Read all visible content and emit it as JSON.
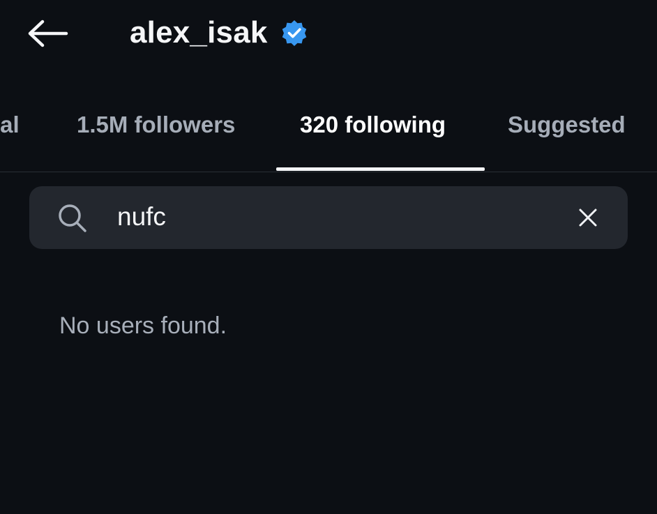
{
  "header": {
    "back_icon": "arrow-left-icon",
    "username": "alex_isak",
    "verified_icon": "verified-badge-icon",
    "verified_color": "#3897f0"
  },
  "tabs": [
    {
      "label": "ual",
      "active": false
    },
    {
      "label": "1.5M followers",
      "active": false
    },
    {
      "label": "320 following",
      "active": true
    },
    {
      "label": "Suggested",
      "active": false
    }
  ],
  "search": {
    "icon": "search-icon",
    "value": "nufc",
    "clear_icon": "close-icon"
  },
  "results": {
    "empty_message": "No users found."
  },
  "colors": {
    "background": "#0c0f14",
    "search_bg": "#23272e",
    "inactive_tab": "#a6adb8"
  }
}
